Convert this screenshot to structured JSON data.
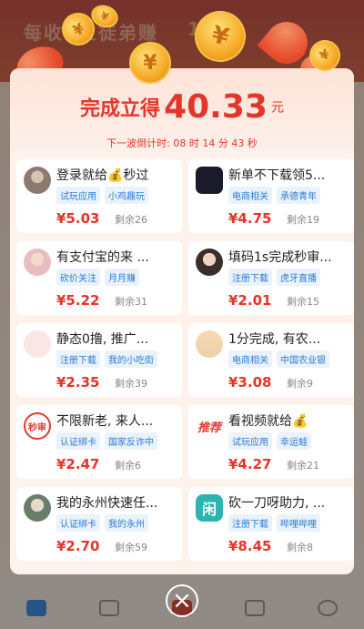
{
  "popup": {
    "headline_prefix": "完成立得",
    "amount": "40.33",
    "unit": "元",
    "countdown": "下一波倒计时: 08 时 14 分 43 秒"
  },
  "background": {
    "banner_text": "每收1位徒弟赚",
    "banner_num": "15"
  },
  "tasks": [
    {
      "title": "登录就给💰秒过",
      "tags": [
        "试玩应用",
        "小鸡趣玩"
      ],
      "price": "¥5.03",
      "remain": "剩余26",
      "avatar": "person-avatar"
    },
    {
      "title": "新单不下载领5...",
      "tags": [
        "电商相关",
        "承德青年"
      ],
      "price": "¥4.75",
      "remain": "剩余19",
      "avatar": "app-icon"
    },
    {
      "title": "有支付宝的来 ...",
      "tags": [
        "砍价关注",
        "月月赚"
      ],
      "price": "¥5.22",
      "remain": "剩余31",
      "avatar": "person-avatar"
    },
    {
      "title": "填码1s完成秒审...",
      "tags": [
        "注册下载",
        "虎牙直播"
      ],
      "price": "¥2.01",
      "remain": "剩余15",
      "avatar": "person-avatar"
    },
    {
      "title": "静态0撸, 推广...",
      "tags": [
        "注册下载",
        "我的小吃街"
      ],
      "price": "¥2.35",
      "remain": "剩余39",
      "avatar": "app-icon"
    },
    {
      "title": "1分完成, 有农...",
      "tags": [
        "电商相关",
        "中国农业银"
      ],
      "price": "¥3.08",
      "remain": "剩余9",
      "avatar": "app-icon"
    },
    {
      "title": "不限新老, 来人...",
      "tags": [
        "认证绑卡",
        "国家反诈中"
      ],
      "price": "¥2.47",
      "remain": "剩余6",
      "avatar": "miaoshen-badge",
      "avatar_text": "秒审"
    },
    {
      "title": "看视频就给💰",
      "tags": [
        "试玩应用",
        "幸运蛙"
      ],
      "price": "¥4.27",
      "remain": "剩余21",
      "avatar": "tuijian-badge",
      "avatar_text": "推荐"
    },
    {
      "title": "我的永州快速任...",
      "tags": [
        "认证绑卡",
        "我的永州"
      ],
      "price": "¥2.70",
      "remain": "剩余59",
      "avatar": "person-avatar"
    },
    {
      "title": "砍一刀呀助力, ...",
      "tags": [
        "注册下载",
        "哔哩哔哩"
      ],
      "price": "¥8.45",
      "remain": "剩余8",
      "avatar": "app-icon",
      "avatar_text": "闲"
    }
  ],
  "colors": {
    "accent_red": "#e6342b",
    "tag_blue": "#2b7ad6",
    "popup_bg": "#fdf2ec"
  }
}
